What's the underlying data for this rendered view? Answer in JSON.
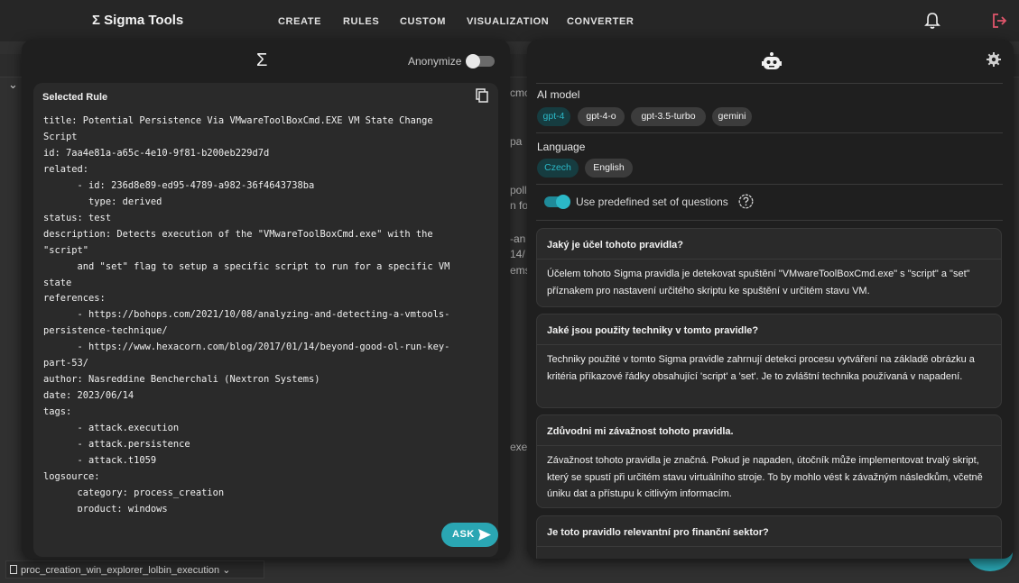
{
  "header": {
    "brand": "Σ Sigma Tools",
    "nav": [
      "CREATE",
      "RULES",
      "CUSTOM",
      "VISUALIZATION",
      "CONVERTER"
    ],
    "icons": [
      "bell-icon",
      "logout-icon"
    ],
    "accent_color": "#e0556b"
  },
  "background": {
    "fragments": [
      "cmo",
      "pa",
      "poll",
      "n fo",
      "-an",
      "14/",
      "ems",
      "exe"
    ],
    "file_row": "proc_creation_win_explorer_lolbin_execution"
  },
  "left_panel": {
    "logo": "Σ",
    "anonymize_label": "Anonymize",
    "anonymize_on": false,
    "card_title": "Selected Rule",
    "rule_lines": [
      "title: Potential Persistence Via VMwareToolBoxCmd.EXE VM State Change",
      "Script",
      "id: 7aa4e81a-a65c-4e10-9f81-b200eb229d7d",
      "related:",
      "      - id: 236d8e89-ed95-4789-a982-36f4643738ba",
      "        type: derived",
      "status: test",
      "description: Detects execution of the \"VMwareToolBoxCmd.exe\" with the",
      "\"script\"",
      "      and \"set\" flag to setup a specific script to run for a specific VM",
      "state",
      "references:",
      "      - https://bohops.com/2021/10/08/analyzing-and-detecting-a-vmtools-",
      "persistence-technique/",
      "      - https://www.hexacorn.com/blog/2017/01/14/beyond-good-ol-run-key-",
      "part-53/",
      "author: Nasreddine Bencherchali (Nextron Systems)",
      "date: 2023/06/14",
      "tags:",
      "      - attack.execution",
      "      - attack.persistence",
      "      - attack.t1059",
      "logsource:",
      "      category: process_creation",
      "      product: windows"
    ],
    "ask_label": "ASK",
    "accent_color": "#2aa6b3"
  },
  "right_panel": {
    "ai_model_label": "AI model",
    "models": [
      "gpt-4",
      "gpt-4-o",
      "gpt-3.5-turbo",
      "gemini"
    ],
    "selected_model": "gpt-4",
    "language_label": "Language",
    "languages": [
      "Czech",
      "English"
    ],
    "selected_language": "Czech",
    "predefined_label": "Use predefined set of questions",
    "predefined_on": true,
    "qa": [
      {
        "question": "Jaký je účel tohoto pravidla?",
        "answer": "Účelem tohoto Sigma pravidla je detekovat spuštění \"VMwareToolBoxCmd.exe\" s \"script\" a \"set\" příznakem pro nastavení určitého skriptu ke spuštění v určitém stavu VM."
      },
      {
        "question": "Jaké jsou použity techniky v tomto pravidle?",
        "answer": "Techniky použité v tomto Sigma pravidle zahrnují detekci procesu vytváření na základě obrázku a kritéria příkazové řádky obsahující 'script' a 'set'. Je to zvláštní technika používaná v napadení."
      },
      {
        "question": "Zdůvodni mi závažnost tohoto pravidla.",
        "answer": "Závažnost tohoto pravidla je značná. Pokud je napaden, útočník může implementovat trvalý skript, který se spustí při určitém stavu virtuálního stroje. To by mohlo vést k závažným následkům, včetně úniku dat a přístupu k citlivým informacím."
      },
      {
        "question": "Je toto pravidlo relevantní pro finanční sektor?",
        "answer": ""
      }
    ]
  }
}
